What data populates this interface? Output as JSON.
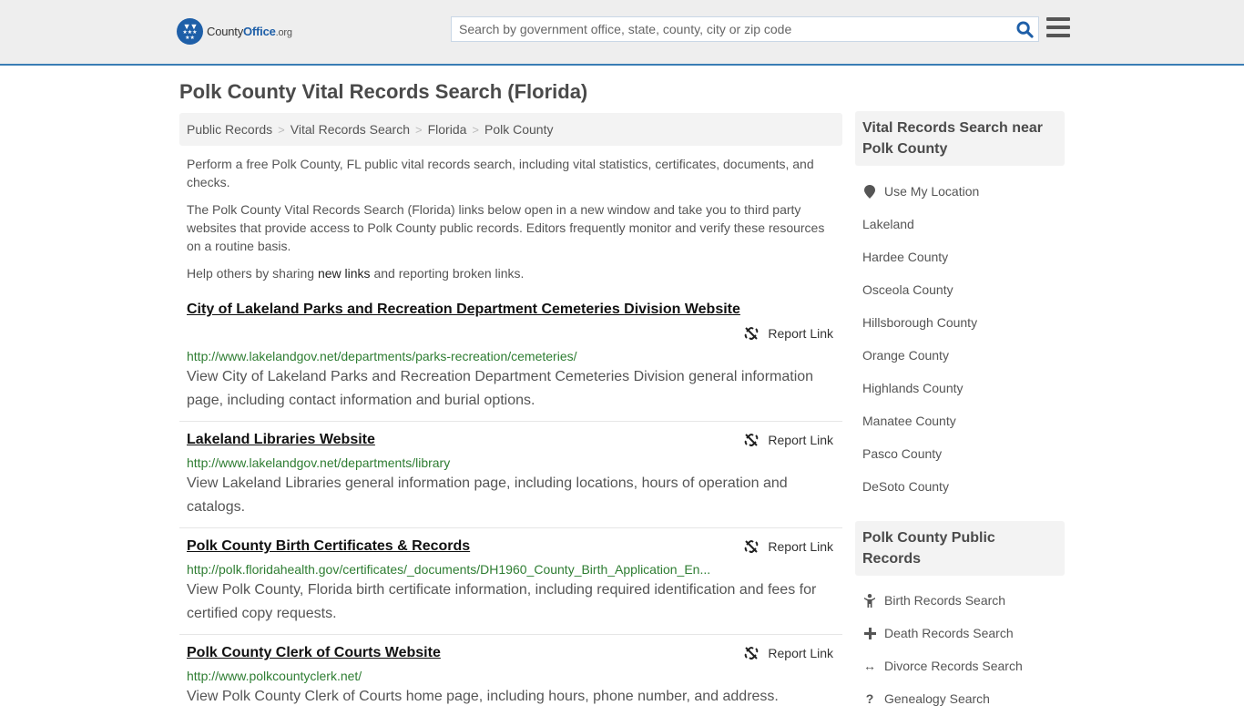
{
  "header": {
    "logo": {
      "name_part1": "County",
      "name_part2": "Office",
      "tld": ".org"
    },
    "search": {
      "placeholder": "Search by government office, state, county, city or zip code",
      "value": ""
    },
    "accent_color": "#3a7db5"
  },
  "page": {
    "title": "Polk County Vital Records Search (Florida)",
    "breadcrumb": [
      "Public Records",
      "Vital Records Search",
      "Florida",
      "Polk County"
    ],
    "intro": {
      "p1": "Perform a free Polk County, FL public vital records search, including vital statistics, certificates, documents, and checks.",
      "p2": "The Polk County Vital Records Search (Florida) links below open in a new window and take you to third party websites that provide access to Polk County public records. Editors frequently monitor and verify these resources on a routine basis.",
      "p3_before": "Help others by sharing ",
      "p3_link": "new links",
      "p3_after": " and reporting broken links."
    },
    "report_label": "Report Link",
    "results": [
      {
        "title": "City of Lakeland Parks and Recreation Department Cemeteries Division Website",
        "url": "http://www.lakelandgov.net/departments/parks-recreation/cemeteries/",
        "description": "View City of Lakeland Parks and Recreation Department Cemeteries Division general information page, including contact information and burial options."
      },
      {
        "title": "Lakeland Libraries Website",
        "url": "http://www.lakelandgov.net/departments/library",
        "description": "View Lakeland Libraries general information page, including locations, hours of operation and catalogs."
      },
      {
        "title": "Polk County Birth Certificates & Records",
        "url": "http://polk.floridahealth.gov/certificates/_documents/DH1960_County_Birth_Application_En...",
        "description": "View Polk County, Florida birth certificate information, including required identification and fees for certified copy requests."
      },
      {
        "title": "Polk County Clerk of Courts Website",
        "url": "http://www.polkcountyclerk.net/",
        "description": "View Polk County Clerk of Courts home page, including hours, phone number, and address."
      }
    ]
  },
  "sidebar": {
    "nearby": {
      "heading": "Vital Records Search near Polk County",
      "use_location": "Use My Location",
      "links": [
        "Lakeland",
        "Hardee County",
        "Osceola County",
        "Hillsborough County",
        "Orange County",
        "Highlands County",
        "Manatee County",
        "Pasco County",
        "DeSoto County"
      ]
    },
    "public_records": {
      "heading": "Polk County Public Records",
      "links": [
        {
          "label": "Birth Records Search",
          "icon": "child-icon"
        },
        {
          "label": "Death Records Search",
          "icon": "cross-icon"
        },
        {
          "label": "Divorce Records Search",
          "icon": "arrows-horizontal-icon"
        },
        {
          "label": "Genealogy Search",
          "icon": "question-icon"
        }
      ]
    }
  }
}
